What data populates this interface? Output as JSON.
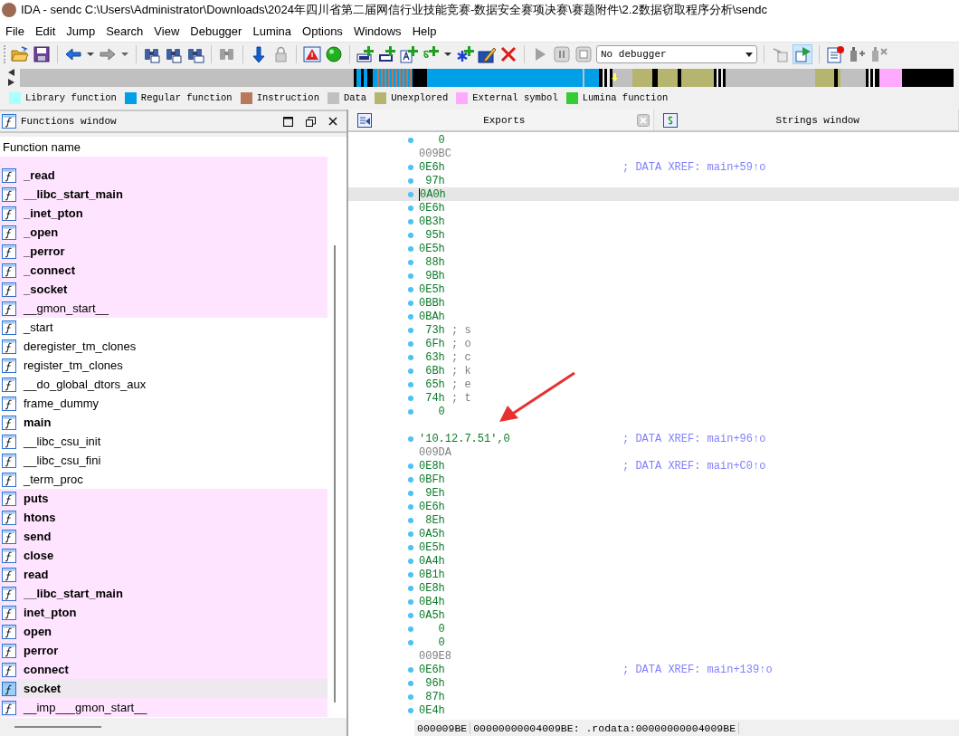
{
  "window": {
    "title": "IDA - sendc C:\\Users\\Administrator\\Downloads\\2024年四川省第二届网信行业技能竞赛-数据安全赛项决赛\\赛题附件\\2.2数据窃取程序分析\\sendc"
  },
  "menu": [
    "File",
    "Edit",
    "Jump",
    "Search",
    "View",
    "Debugger",
    "Lumina",
    "Options",
    "Windows",
    "Help"
  ],
  "debugger": {
    "value": "No debugger"
  },
  "legend": [
    {
      "label": "Library function",
      "color": "#aaffff"
    },
    {
      "label": "Regular function",
      "color": "#00a0e8"
    },
    {
      "label": "Instruction",
      "color": "#b8785a"
    },
    {
      "label": "Data",
      "color": "#c0c0c0"
    },
    {
      "label": "Unexplored",
      "color": "#b5b56f"
    },
    {
      "label": "External symbol",
      "color": "#ffaaff"
    },
    {
      "label": "Lumina function",
      "color": "#33cc33"
    }
  ],
  "functions_window": {
    "title": "Functions window",
    "column": "Function name",
    "rows": [
      {
        "name": "_read",
        "bold": true,
        "external": true,
        "selected": false
      },
      {
        "name": "__libc_start_main",
        "bold": true,
        "external": true,
        "selected": false
      },
      {
        "name": "_inet_pton",
        "bold": true,
        "external": true,
        "selected": false
      },
      {
        "name": "_open",
        "bold": true,
        "external": true,
        "selected": false
      },
      {
        "name": "_perror",
        "bold": true,
        "external": true,
        "selected": false
      },
      {
        "name": "_connect",
        "bold": true,
        "external": true,
        "selected": false
      },
      {
        "name": "_socket",
        "bold": true,
        "external": true,
        "selected": false
      },
      {
        "name": "__gmon_start__",
        "bold": false,
        "external": true,
        "selected": false
      },
      {
        "name": "_start",
        "bold": false,
        "external": false,
        "selected": false
      },
      {
        "name": "deregister_tm_clones",
        "bold": false,
        "external": false,
        "selected": false
      },
      {
        "name": "register_tm_clones",
        "bold": false,
        "external": false,
        "selected": false
      },
      {
        "name": "__do_global_dtors_aux",
        "bold": false,
        "external": false,
        "selected": false
      },
      {
        "name": "frame_dummy",
        "bold": false,
        "external": false,
        "selected": false
      },
      {
        "name": "main",
        "bold": true,
        "external": false,
        "selected": false
      },
      {
        "name": "__libc_csu_init",
        "bold": false,
        "external": false,
        "selected": false
      },
      {
        "name": "__libc_csu_fini",
        "bold": false,
        "external": false,
        "selected": false
      },
      {
        "name": "_term_proc",
        "bold": false,
        "external": false,
        "selected": false
      },
      {
        "name": "puts",
        "bold": true,
        "external": true,
        "selected": false
      },
      {
        "name": "htons",
        "bold": true,
        "external": true,
        "selected": false
      },
      {
        "name": "send",
        "bold": true,
        "external": true,
        "selected": false
      },
      {
        "name": "close",
        "bold": true,
        "external": true,
        "selected": false
      },
      {
        "name": "read",
        "bold": true,
        "external": true,
        "selected": false
      },
      {
        "name": "__libc_start_main",
        "bold": true,
        "external": true,
        "selected": false
      },
      {
        "name": "inet_pton",
        "bold": true,
        "external": true,
        "selected": false
      },
      {
        "name": "open",
        "bold": true,
        "external": true,
        "selected": false
      },
      {
        "name": "perror",
        "bold": true,
        "external": true,
        "selected": false
      },
      {
        "name": "connect",
        "bold": true,
        "external": true,
        "selected": false
      },
      {
        "name": "socket",
        "bold": true,
        "external": true,
        "selected": true
      },
      {
        "name": "__imp___gmon_start__",
        "bold": false,
        "external": true,
        "selected": false
      }
    ]
  },
  "tabs": [
    {
      "label": "Exports",
      "selected": true
    },
    {
      "label": "Strings window",
      "selected": false
    }
  ],
  "listing": {
    "lines": [
      {
        "kind": "byte",
        "dot": true,
        "text": "0",
        "selected": false
      },
      {
        "kind": "address",
        "dot": false,
        "text": "009BC",
        "selected": false
      },
      {
        "kind": "byte",
        "dot": true,
        "text": "0E6h",
        "comment": "; DATA XREF: main+59↑o",
        "selected": false
      },
      {
        "kind": "byte",
        "dot": true,
        "text": "97h",
        "selected": false
      },
      {
        "kind": "byte",
        "dot": true,
        "text": "0A0h",
        "selected": true
      },
      {
        "kind": "byte",
        "dot": true,
        "text": "0E6h",
        "selected": false
      },
      {
        "kind": "byte",
        "dot": true,
        "text": "0B3h",
        "selected": false
      },
      {
        "kind": "byte",
        "dot": true,
        "text": "95h",
        "selected": false
      },
      {
        "kind": "byte",
        "dot": true,
        "text": "0E5h",
        "selected": false
      },
      {
        "kind": "byte",
        "dot": true,
        "text": "88h",
        "selected": false
      },
      {
        "kind": "byte",
        "dot": true,
        "text": "9Bh",
        "selected": false
      },
      {
        "kind": "byte",
        "dot": true,
        "text": "0E5h",
        "selected": false
      },
      {
        "kind": "byte",
        "dot": true,
        "text": "0BBh",
        "selected": false
      },
      {
        "kind": "byte",
        "dot": true,
        "text": "0BAh",
        "selected": false
      },
      {
        "kind": "byte",
        "dot": true,
        "text": "73h",
        "char": "; s",
        "selected": false
      },
      {
        "kind": "byte",
        "dot": true,
        "text": "6Fh",
        "char": "; o",
        "selected": false
      },
      {
        "kind": "byte",
        "dot": true,
        "text": "63h",
        "char": "; c",
        "selected": false
      },
      {
        "kind": "byte",
        "dot": true,
        "text": "6Bh",
        "char": "; k",
        "selected": false
      },
      {
        "kind": "byte",
        "dot": true,
        "text": "65h",
        "char": "; e",
        "selected": false
      },
      {
        "kind": "byte",
        "dot": true,
        "text": "74h",
        "char": "; t",
        "selected": false
      },
      {
        "kind": "byte",
        "dot": true,
        "text": "0",
        "selected": false
      },
      {
        "kind": "blank"
      },
      {
        "kind": "string",
        "dot": true,
        "text": "'10.12.7.51',0",
        "comment": "; DATA XREF: main+96↑o",
        "selected": false
      },
      {
        "kind": "address",
        "dot": false,
        "text": "009DA",
        "selected": false
      },
      {
        "kind": "byte",
        "dot": true,
        "text": "0E8h",
        "comment": "; DATA XREF: main+C0↑o",
        "selected": false
      },
      {
        "kind": "byte",
        "dot": true,
        "text": "0BFh",
        "selected": false
      },
      {
        "kind": "byte",
        "dot": true,
        "text": "9Eh",
        "selected": false
      },
      {
        "kind": "byte",
        "dot": true,
        "text": "0E6h",
        "selected": false
      },
      {
        "kind": "byte",
        "dot": true,
        "text": "8Eh",
        "selected": false
      },
      {
        "kind": "byte",
        "dot": true,
        "text": "0A5h",
        "selected": false
      },
      {
        "kind": "byte",
        "dot": true,
        "text": "0E5h",
        "selected": false
      },
      {
        "kind": "byte",
        "dot": true,
        "text": "0A4h",
        "selected": false
      },
      {
        "kind": "byte",
        "dot": true,
        "text": "0B1h",
        "selected": false
      },
      {
        "kind": "byte",
        "dot": true,
        "text": "0E8h",
        "selected": false
      },
      {
        "kind": "byte",
        "dot": true,
        "text": "0B4h",
        "selected": false
      },
      {
        "kind": "byte",
        "dot": true,
        "text": "0A5h",
        "selected": false
      },
      {
        "kind": "byte",
        "dot": true,
        "text": "0",
        "selected": false
      },
      {
        "kind": "byte",
        "dot": true,
        "text": "0",
        "selected": false
      },
      {
        "kind": "address",
        "dot": false,
        "text": "009E8",
        "selected": false
      },
      {
        "kind": "byte",
        "dot": true,
        "text": "0E6h",
        "comment": "; DATA XREF: main+139↑o",
        "selected": false
      },
      {
        "kind": "byte",
        "dot": true,
        "text": "96h",
        "selected": false
      },
      {
        "kind": "byte",
        "dot": true,
        "text": "87h",
        "selected": false
      },
      {
        "kind": "byte",
        "dot": true,
        "text": "0E4h",
        "selected": false
      }
    ]
  },
  "status_bar": [
    "000009BE",
    "00000000004009BE: .rodata:00000000004009BE"
  ]
}
